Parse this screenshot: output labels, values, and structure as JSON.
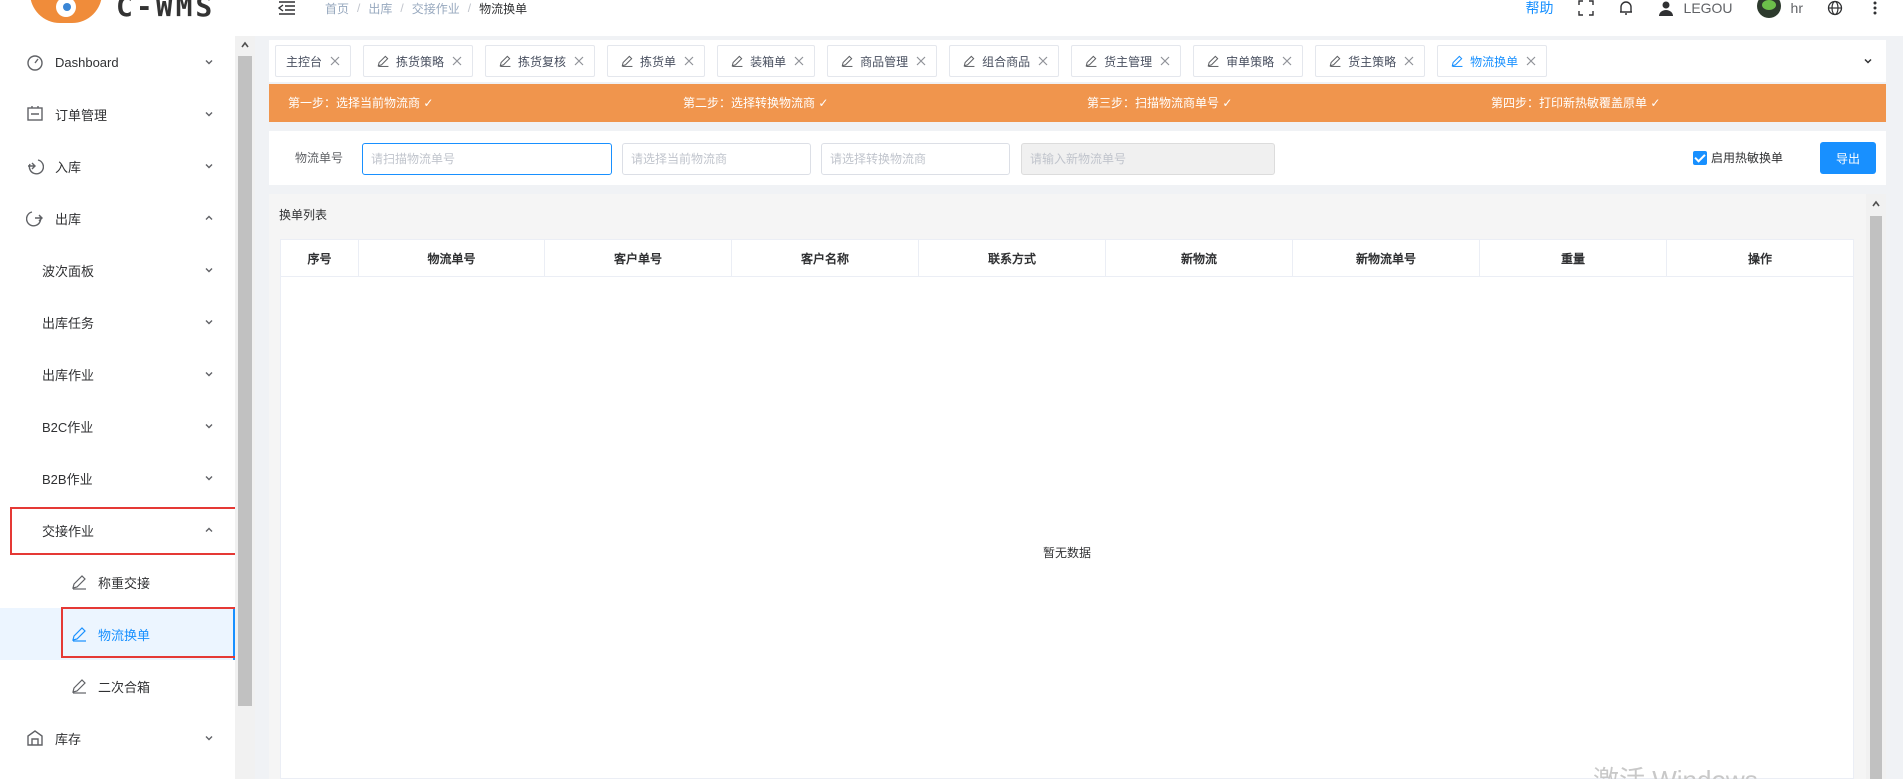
{
  "logo": {
    "text": "C-WMS"
  },
  "sidebar": {
    "items": [
      {
        "label": "Dashboard",
        "icon": "dashboard-icon",
        "level": 0,
        "expanded": false
      },
      {
        "label": "订单管理",
        "icon": "order-icon",
        "level": 0,
        "expanded": false
      },
      {
        "label": "入库",
        "icon": "inbound-icon",
        "level": 0,
        "expanded": false
      },
      {
        "label": "出库",
        "icon": "outbound-icon",
        "level": 0,
        "expanded": true
      },
      {
        "label": "波次面板",
        "level": 1,
        "expanded": false
      },
      {
        "label": "出库任务",
        "level": 1,
        "expanded": false
      },
      {
        "label": "出库作业",
        "level": 1,
        "expanded": false
      },
      {
        "label": "B2C作业",
        "level": 1,
        "expanded": false
      },
      {
        "label": "B2B作业",
        "level": 1,
        "expanded": false
      },
      {
        "label": "交接作业",
        "level": 1,
        "expanded": true
      },
      {
        "label": "称重交接",
        "icon": "edit-icon",
        "level": 2
      },
      {
        "label": "物流换单",
        "icon": "edit-icon",
        "level": 2,
        "active": true
      },
      {
        "label": "二次合箱",
        "icon": "edit-icon",
        "level": 2
      },
      {
        "label": "库存",
        "icon": "inventory-icon",
        "level": 0,
        "expanded": false
      }
    ]
  },
  "header": {
    "breadcrumb": [
      "首页",
      "出库",
      "交接作业",
      "物流换单"
    ],
    "help": "帮助",
    "user": "LEGOU",
    "profile": "hr"
  },
  "tabs": [
    {
      "label": "主控台",
      "icon": false,
      "active": false
    },
    {
      "label": "拣货策略",
      "icon": true,
      "active": false
    },
    {
      "label": "拣货复核",
      "icon": true,
      "active": false
    },
    {
      "label": "拣货单",
      "icon": true,
      "active": false
    },
    {
      "label": "装箱单",
      "icon": true,
      "active": false
    },
    {
      "label": "商品管理",
      "icon": true,
      "active": false
    },
    {
      "label": "组合商品",
      "icon": true,
      "active": false
    },
    {
      "label": "货主管理",
      "icon": true,
      "active": false
    },
    {
      "label": "审单策略",
      "icon": true,
      "active": false
    },
    {
      "label": "货主策略",
      "icon": true,
      "active": false
    },
    {
      "label": "物流换单",
      "icon": true,
      "active": true
    }
  ],
  "steps": [
    "第一步：选择当前物流商 ✓",
    "第二步：选择转换物流商 ✓",
    "第三步：扫描物流商单号 ✓",
    "第四步：打印新热敏覆盖原单 ✓"
  ],
  "filter": {
    "label": "物流单号",
    "scan_placeholder": "请扫描物流单号",
    "current_carrier_placeholder": "请选择当前物流商",
    "convert_carrier_placeholder": "请选择转换物流商",
    "new_number_placeholder": "请输入新物流单号",
    "enable_thermal_label": "启用热敏换单",
    "enable_thermal_checked": true,
    "export_label": "导出"
  },
  "table": {
    "title": "换单列表",
    "columns": [
      "序号",
      "物流单号",
      "客户单号",
      "客户名称",
      "联系方式",
      "新物流",
      "新物流单号",
      "重量",
      "操作"
    ],
    "rows": [],
    "empty_text": "暂无数据"
  },
  "watermark": "激活 Windows",
  "colors": {
    "accent": "#1890ff",
    "steps_bg": "#f0954d",
    "highlight_box": "#e53935"
  }
}
